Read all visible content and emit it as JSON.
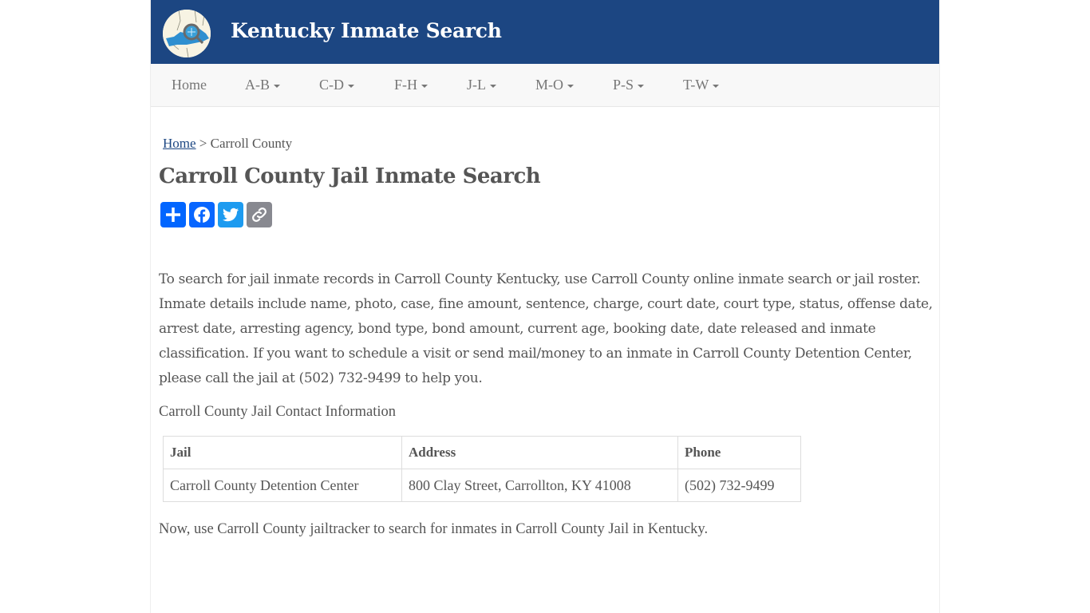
{
  "header": {
    "site_title": "Kentucky Inmate Search",
    "logo_icon": "kentucky-map-magnifier-icon",
    "brand_color": "#1c4682"
  },
  "nav": {
    "items": [
      {
        "label": "Home",
        "dropdown": false
      },
      {
        "label": "A-B",
        "dropdown": true
      },
      {
        "label": "C-D",
        "dropdown": true
      },
      {
        "label": "F-H",
        "dropdown": true
      },
      {
        "label": "J-L",
        "dropdown": true
      },
      {
        "label": "M-O",
        "dropdown": true
      },
      {
        "label": "P-S",
        "dropdown": true
      },
      {
        "label": "T-W",
        "dropdown": true
      }
    ]
  },
  "breadcrumb": {
    "home": "Home",
    "separator": ">",
    "current": "Carroll County"
  },
  "page_title": "Carroll County Jail Inmate Search",
  "share": {
    "buttons": [
      {
        "name": "share",
        "icon": "plus-icon",
        "color": "#0166ff"
      },
      {
        "name": "facebook",
        "icon": "facebook-icon",
        "color": "#0866ff"
      },
      {
        "name": "twitter",
        "icon": "twitter-icon",
        "color": "#1d9bf0"
      },
      {
        "name": "copy-link",
        "icon": "link-icon",
        "color": "#888990"
      }
    ]
  },
  "intro": "To search for jail inmate records in Carroll County Kentucky, use Carroll County online inmate search or jail roster. Inmate details include name, photo, case, fine amount, sentence, charge, court date, court type, status, offense date, arrest date, arresting agency, bond type, bond amount, current age, booking date, date released and inmate classification. If you want to schedule a visit or send mail/money to an inmate in Carroll County Detention Center, please call the jail at (502) 732-9499 to help you.",
  "contact_heading": "Carroll County Jail Contact Information",
  "contact_table": {
    "headers": [
      "Jail",
      "Address",
      "Phone"
    ],
    "rows": [
      [
        "Carroll County Detention Center",
        "800 Clay Street, Carrollton, KY 41008",
        "(502) 732-9499"
      ]
    ]
  },
  "footer_note": "Now, use Carroll County jailtracker to search for inmates in Carroll County Jail in Kentucky."
}
